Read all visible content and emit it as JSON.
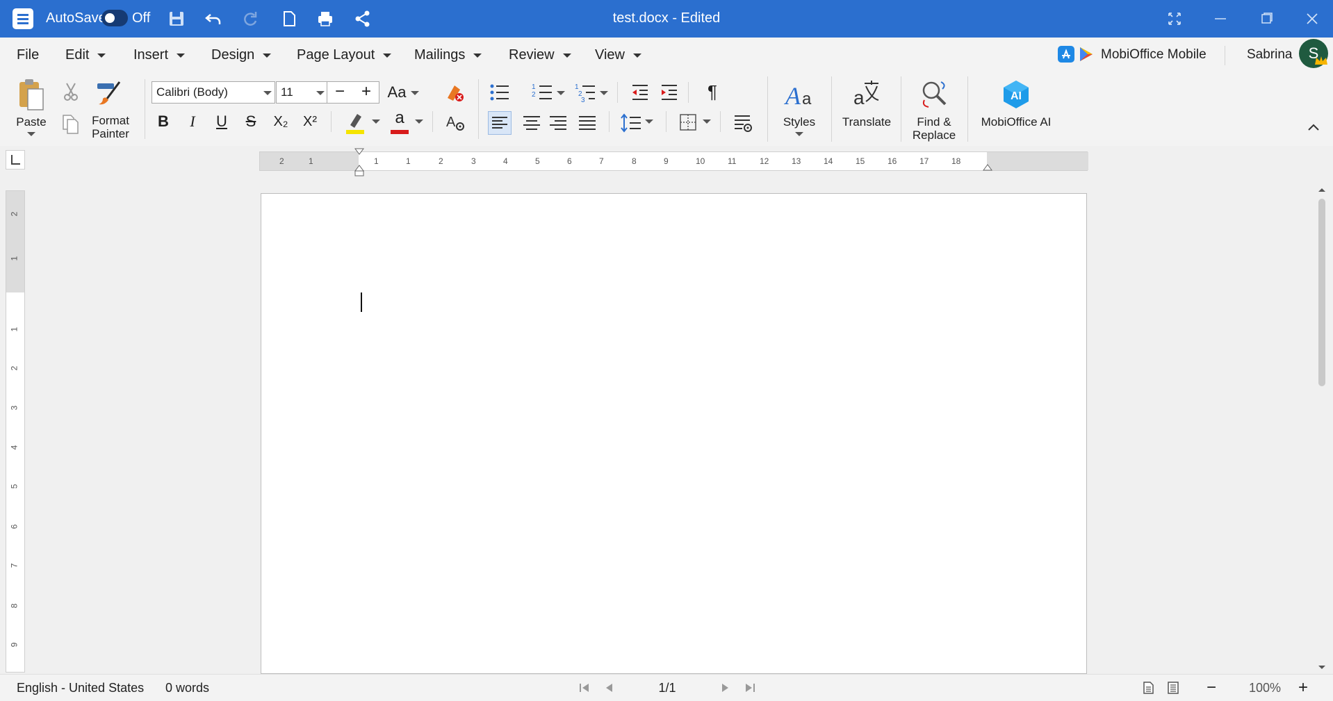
{
  "titlebar": {
    "autosave_label": "AutoSave",
    "autosave_state": "Off",
    "doc_title": "test.docx - Edited",
    "icons": [
      "hamburger-menu-icon",
      "save-icon",
      "undo-icon",
      "redo-icon",
      "new-document-icon",
      "print-icon",
      "share-icon",
      "fullscreen-icon",
      "minimize-icon",
      "restore-icon",
      "close-icon"
    ]
  },
  "menubar": {
    "items": [
      {
        "label": "File"
      },
      {
        "label": "Edit"
      },
      {
        "label": "Insert"
      },
      {
        "label": "Design"
      },
      {
        "label": "Page Layout"
      },
      {
        "label": "Mailings"
      },
      {
        "label": "Review"
      },
      {
        "label": "View"
      }
    ],
    "promo_label": "MobiOffice Mobile",
    "user_name": "Sabrina",
    "avatar_initial": "S"
  },
  "ribbon": {
    "paste_label": "Paste",
    "format_painter_label": "Format\nPainter",
    "font_name": "Calibri (Body)",
    "font_size": "11",
    "decrease_size": "−",
    "increase_size": "+",
    "change_case": "Aa",
    "bold": "B",
    "italic": "I",
    "underline": "U",
    "strike": "S",
    "subscript": "X₂",
    "superscript": "X²",
    "font_color_glyph": "a",
    "pilcrow": "¶",
    "styles_label": "Styles",
    "translate_label": "Translate",
    "find_replace_label": "Find &\nReplace",
    "ai_label": "MobiOffice AI",
    "ai_badge": "AI",
    "highlight_color": "#f5e400",
    "font_color": "#d81b1b"
  },
  "ruler": {
    "h_numbers": [
      "2",
      "1",
      "1",
      "1",
      "2",
      "3",
      "4",
      "5",
      "6",
      "7",
      "8",
      "9",
      "10",
      "11",
      "12",
      "13",
      "14",
      "15",
      "16",
      "17",
      "18"
    ],
    "v_numbers": [
      "2",
      "1",
      "1",
      "2",
      "3",
      "4",
      "5",
      "6",
      "7",
      "8",
      "9"
    ]
  },
  "statusbar": {
    "language": "English - United States",
    "word_count": "0 words",
    "page_indicator": "1/1",
    "zoom": "100%",
    "zoom_out": "−",
    "zoom_in": "+"
  }
}
